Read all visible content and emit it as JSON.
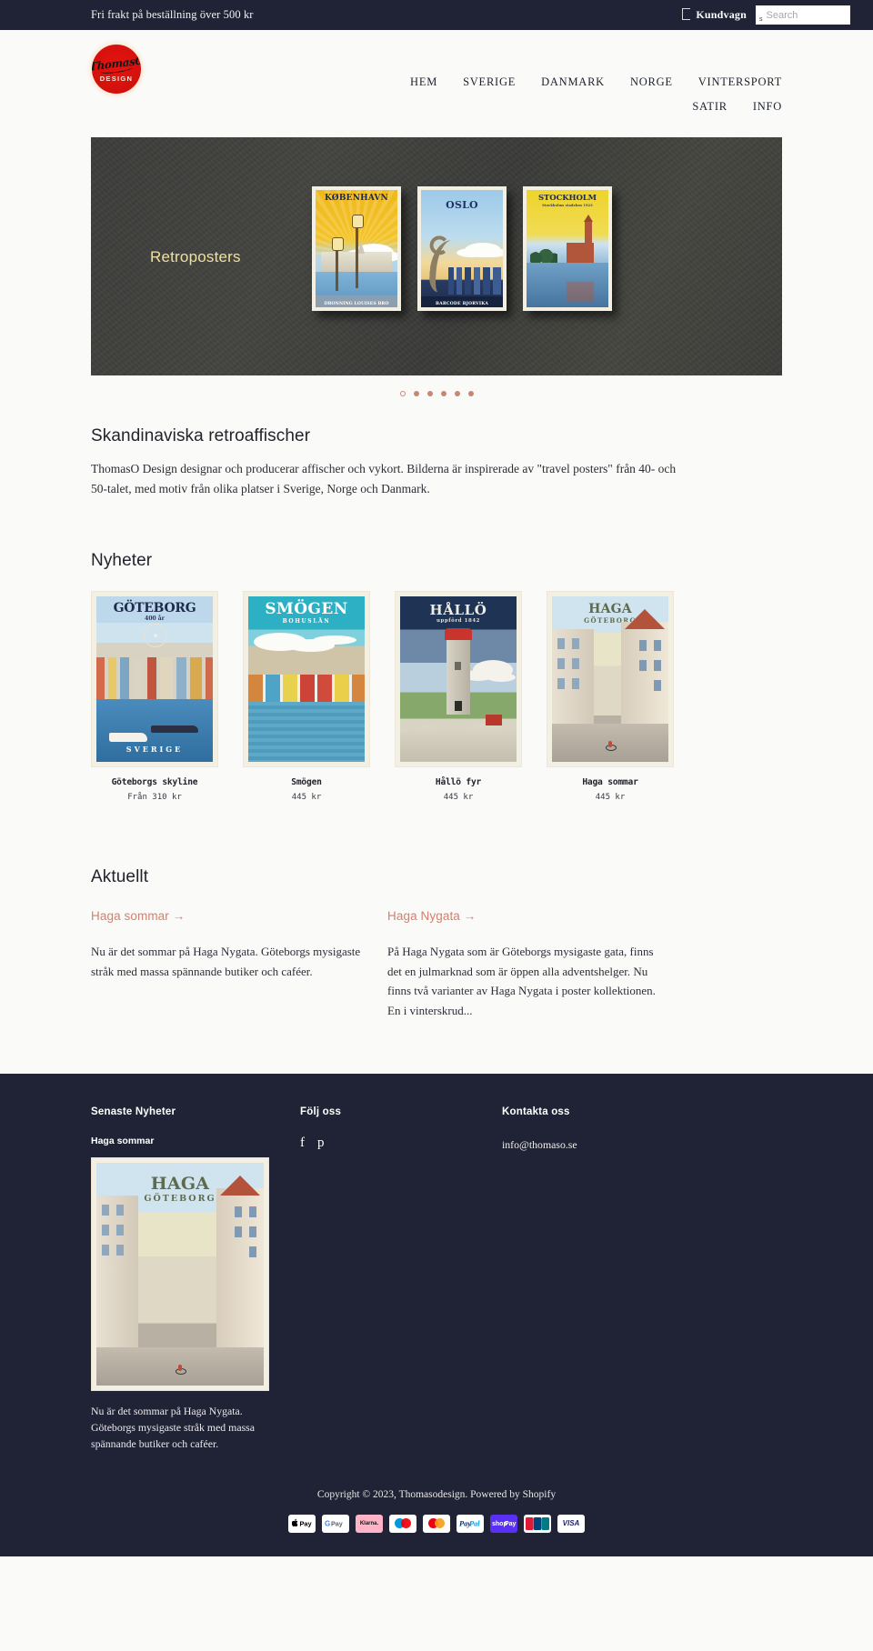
{
  "announcement": {
    "text": "Fri frakt på beställning över 500 kr",
    "cart_label": "Kundvagn",
    "search_placeholder": "Search",
    "search_value": "",
    "search_glyph": "s"
  },
  "brand": {
    "logo_script": "ThomasO",
    "logo_sub": "DESIGN",
    "accent_red": "#d5110d"
  },
  "nav": {
    "row1": [
      {
        "label": "HEM"
      },
      {
        "label": "SVERIGE"
      },
      {
        "label": "DANMARK"
      },
      {
        "label": "NORGE"
      },
      {
        "label": "VINTERSPORT"
      }
    ],
    "row2": [
      {
        "label": "SATIR"
      },
      {
        "label": "INFO"
      }
    ]
  },
  "hero": {
    "title": "Retroposters",
    "accent_color": "#f2e09b",
    "posters": [
      {
        "title": "KØBENHAVN",
        "subtitle": "DRONNING LOUISES BRO"
      },
      {
        "title": "OSLO",
        "subtitle": "BARCODE BJORVIKA"
      },
      {
        "title": "STOCKHOLM",
        "subtitle": "Stockholms stadshus 1923"
      }
    ],
    "dots": {
      "count": 6,
      "active_index": 0,
      "color": "#c98673"
    }
  },
  "intro": {
    "title": "Skandinaviska retroaffischer",
    "paragraph": "ThomasO Design designar och producerar affischer och vykort. Bilderna är inspirerade av \"travel posters\" från 40- och 50-talet, med  motiv från olika platser i Sverige, Norge och Danmark."
  },
  "products": {
    "title": "Nyheter",
    "items": [
      {
        "title": "Göteborgs skyline",
        "price": "Från 310 kr",
        "art_class": "a-gbg",
        "header": "GÖTEBORG",
        "sub": "400 år",
        "footer_label": "SVERIGE"
      },
      {
        "title": "Smögen",
        "price": "445 kr",
        "art_class": "a-smo",
        "header": "SMÖGEN",
        "sub": "BOHUSLÄN",
        "footer_label": ""
      },
      {
        "title": "Hållö fyr",
        "price": "445 kr",
        "art_class": "a-hal",
        "header": "HÅLLÖ",
        "sub": "uppförd 1842",
        "footer_label": ""
      },
      {
        "title": "Haga sommar",
        "price": "445 kr",
        "art_class": "a-haga",
        "header": "HAGA",
        "sub": "GÖTEBORG",
        "footer_label": ""
      }
    ]
  },
  "blog": {
    "title": "Aktuellt",
    "posts": [
      {
        "link": "Haga sommar →",
        "excerpt": "Nu är det sommar på Haga Nygata. Göteborgs mysigaste stråk med massa spännande butiker och caféer."
      },
      {
        "link": "Haga Nygata →",
        "excerpt": " På Haga Nygata som är Göteborgs mysigaste gata, finns det en julmarknad som är öppen alla adventshelger. Nu finns två varianter av Haga Nygata i poster kollektionen. En i vinterskrud..."
      }
    ]
  },
  "footer": {
    "col1": {
      "heading": "Senaste Nyheter",
      "post_title": "Haga sommar",
      "thumb_header": "HAGA",
      "thumb_sub": "GÖTEBORG",
      "caption": "Nu är det sommar på Haga Nygata. Göteborgs mysigaste stråk med massa spännande butiker och caféer."
    },
    "col2": {
      "heading": "Följ oss",
      "socials": [
        {
          "name": "facebook",
          "glyph": "f"
        },
        {
          "name": "pinterest",
          "glyph": "p"
        }
      ]
    },
    "col3": {
      "heading": "Kontakta oss",
      "email": "info@thomaso.se"
    },
    "copyright_prefix": "Copyright © 2023, ",
    "shop_name": "Thomasodesign",
    "copyright_mid": ". Powered by ",
    "platform": "Shopify",
    "payments": [
      {
        "name": "apple-pay",
        "label": " Pay"
      },
      {
        "name": "google-pay",
        "label": "G Pay"
      },
      {
        "name": "klarna",
        "label": "Klarna."
      },
      {
        "name": "maestro",
        "label": ""
      },
      {
        "name": "mastercard",
        "label": ""
      },
      {
        "name": "paypal",
        "label": "PayPal"
      },
      {
        "name": "shop-pay",
        "label": "shop Pay"
      },
      {
        "name": "unionpay",
        "label": "UnionPay"
      },
      {
        "name": "visa",
        "label": "VISA"
      }
    ]
  }
}
